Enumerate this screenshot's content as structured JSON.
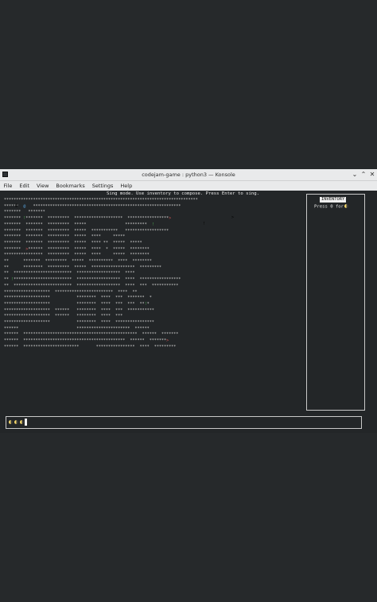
{
  "window": {
    "title": "codejam-game : python3 — Konsole",
    "minimize_icon": "chevron-down-icon",
    "maximize_icon": "chevron-up-icon",
    "close_icon": "close-icon",
    "min_glyph": "⌄",
    "max_glyph": "⌃",
    "close_glyph": "✕"
  },
  "menu": {
    "items": [
      "File",
      "Edit",
      "View",
      "Bookmarks",
      "Settings",
      "Help"
    ]
  },
  "game": {
    "mode_message": "Sing mode. Use inventory to compose. Press Enter to sing.",
    "map_rows": [
      "********************************************************************************",
      "******  @   *************************************************************",
      "*******   *******",
      "******* !*******  *********  ********************  *****************>",
      "*******  *******  *********  *****                *********  !",
      "*******  *******  *********  *****  ***********   ******************",
      "*******  *******  *********  *****  ****     *****",
      "*******  *******  *********  *****  **** **  *****  *****",
      "*******  >******  *********  *****  ****  *  *****  ********",
      "****************  *********  *****  ****     *****  ********",
      "**      *******  *********  *****  **********  ****  ********",
      "**      ********  *********  *****  ******************  *********",
      "**  ************************  ******************  ****",
      "** !************************  ******************  ****  *****************",
      "**  ************************  ******************  ****  ***  ***********",
      "*******************  ************************  ****  **",
      "*******************           ********  ****  ***  *******  *",
      "*******************           ********  ****  ***  ***  **!*",
      "*******************  ******   ********  ****  ***  ***********",
      "*******************  ******   ********  ****  ***",
      "*******************           ********  ****  ****************",
      "******                        **********************  ******",
      "******  ***********************************************  ******  *******",
      "******  ******************************************  ******  *******>",
      "******  ***********************       ****************  ****  *********"
    ],
    "sprites": [
      {
        "glyph": "@",
        "color": "#5aa9e6"
      },
      {
        "glyph": "!",
        "color": "#4caf50"
      },
      {
        "glyph": ">",
        "color": "#e05a5a"
      }
    ],
    "inventory": {
      "title": "INVENTORY",
      "hint": "Press 0 for",
      "hint_icon": "moon-note-icon"
    },
    "compose": {
      "notes": [
        "half-moon",
        "half-moon",
        "half-moon"
      ]
    }
  },
  "colors": {
    "background": "#26292b",
    "terminal_bg": "#232628",
    "text": "#d8d8d8",
    "note": "#f5d86a",
    "player": "#5aa9e6",
    "item": "#4caf50",
    "enemy": "#e05a5a"
  }
}
